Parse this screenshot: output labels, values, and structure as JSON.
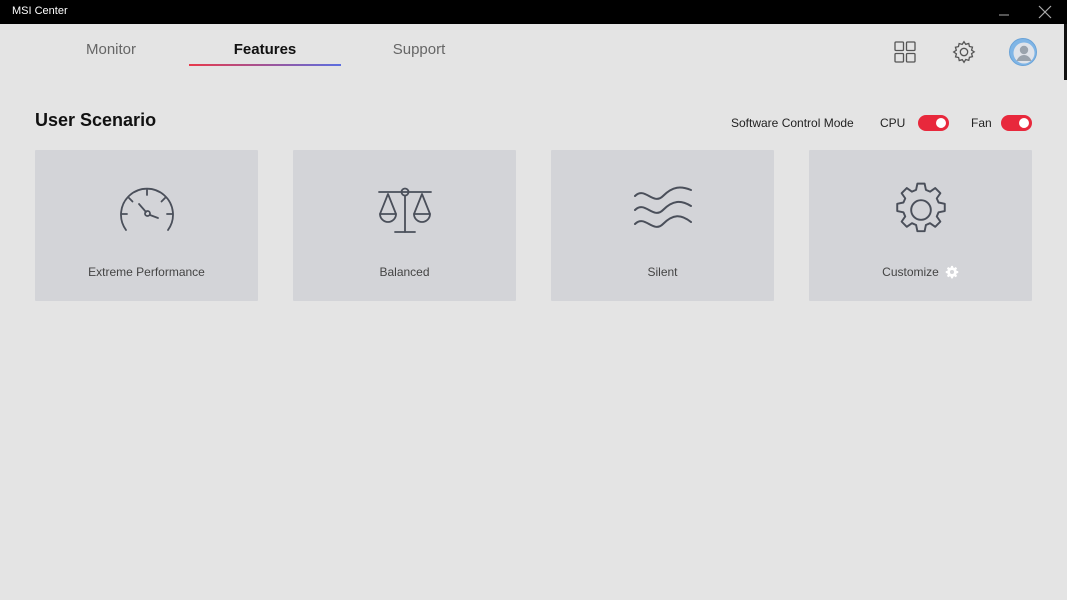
{
  "window": {
    "title": "MSI Center",
    "minimize_icon": "minimize-icon",
    "close_icon": "close-icon"
  },
  "tabs": [
    {
      "label": "Monitor",
      "active": false
    },
    {
      "label": "Features",
      "active": true
    },
    {
      "label": "Support",
      "active": false
    }
  ],
  "header_icons": [
    "grid-icon",
    "gear-icon",
    "avatar"
  ],
  "section": {
    "title": "User Scenario",
    "software_control_mode_label": "Software Control Mode",
    "cpu": {
      "label": "CPU",
      "enabled": true
    },
    "fan": {
      "label": "Fan",
      "enabled": true
    }
  },
  "scenarios": [
    {
      "label": "Extreme Performance",
      "icon": "speedometer-icon"
    },
    {
      "label": "Balanced",
      "icon": "scale-icon"
    },
    {
      "label": "Silent",
      "icon": "waves-icon"
    },
    {
      "label": "Customize",
      "icon": "gear-icon",
      "has_settings_icon": true
    }
  ],
  "colors": {
    "accent": "#e8283c",
    "tab_gradient_start": "#e8394b",
    "tab_gradient_end": "#5b6ee0",
    "background": "#e4e4e4",
    "card": "#d3d4d8"
  }
}
